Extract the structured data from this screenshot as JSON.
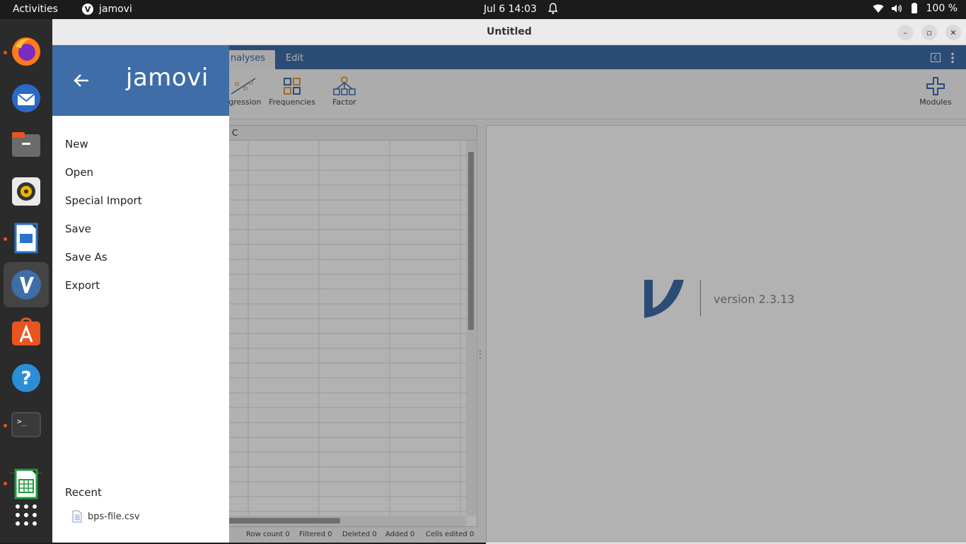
{
  "topbar": {
    "activities": "Activities",
    "app_name": "jamovi",
    "clock": "Jul 6  14:03",
    "battery": "100 %"
  },
  "window": {
    "title": "Untitled"
  },
  "tabs": [
    {
      "label": "nalyses",
      "active": true
    },
    {
      "label": "Edit",
      "active": false
    }
  ],
  "ribbon": {
    "regression": "egression",
    "frequencies": "Frequencies",
    "factor": "Factor",
    "modules": "Modules"
  },
  "grid": {
    "column_header": "C"
  },
  "results": {
    "version": "version 2.3.13"
  },
  "status": {
    "row_count": "Row count 0",
    "filtered": "Filtered 0",
    "deleted": "Deleted 0",
    "added": "Added 0",
    "cells_edited": "Cells edited 0"
  },
  "menu": {
    "logo": "jamovi",
    "items": [
      "New",
      "Open",
      "Special Import",
      "Save",
      "Save As",
      "Export"
    ],
    "recent_title": "Recent",
    "recent_files": [
      "bps-file.csv"
    ]
  },
  "colors": {
    "brand_blue": "#3e6da8",
    "accent_orange": "#e95420"
  }
}
